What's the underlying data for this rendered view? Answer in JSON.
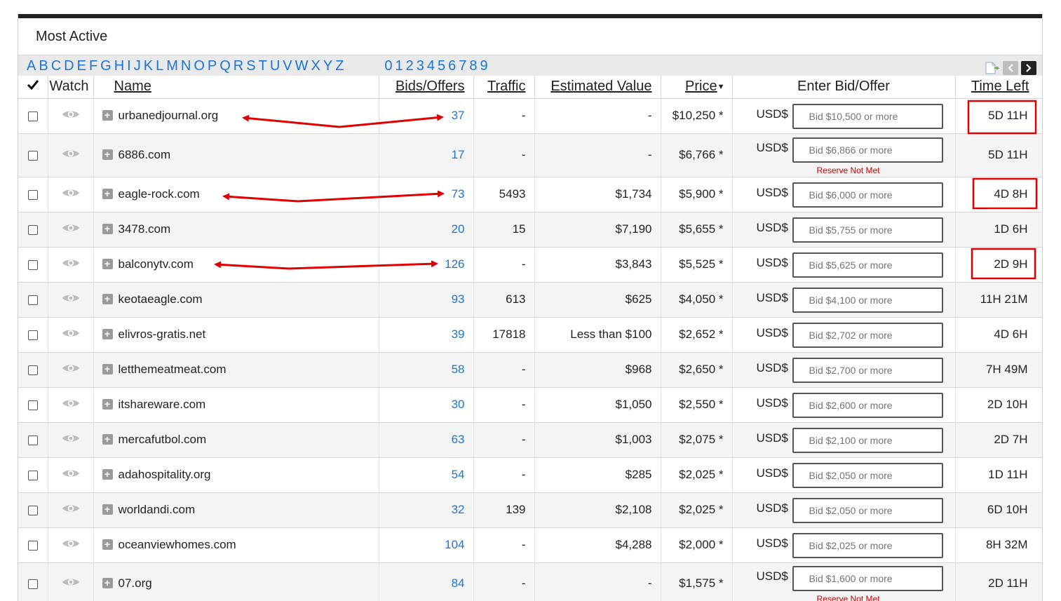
{
  "panel": {
    "title": "Most Active"
  },
  "alphabet": {
    "letters": [
      "A",
      "B",
      "C",
      "D",
      "E",
      "F",
      "G",
      "H",
      "I",
      "J",
      "K",
      "L",
      "M",
      "N",
      "O",
      "P",
      "Q",
      "R",
      "S",
      "T",
      "U",
      "V",
      "W",
      "X",
      "Y",
      "Z"
    ],
    "digits": [
      "0",
      "1",
      "2",
      "3",
      "4",
      "5",
      "6",
      "7",
      "8",
      "9"
    ]
  },
  "columns": {
    "check": "✔",
    "watch": "Watch",
    "name": "Name",
    "bids": "Bids/Offers",
    "traffic": "Traffic",
    "estimated": "Estimated Value",
    "price": "Price",
    "enter_bid": "Enter Bid/Offer",
    "time_left": "Time Left"
  },
  "currency_label": "USD$",
  "rows": [
    {
      "name": "urbanedjournal.org",
      "bids": "37",
      "traffic": "-",
      "estimated": "-",
      "price": "$10,250 *",
      "placeholder": "Bid $10,500 or more",
      "reserve": "",
      "time": "5D 11H"
    },
    {
      "name": "6886.com",
      "bids": "17",
      "traffic": "-",
      "estimated": "-",
      "price": "$6,766 *",
      "placeholder": "Bid $6,866 or more",
      "reserve": "Reserve Not Met",
      "time": "5D 11H"
    },
    {
      "name": "eagle-rock.com",
      "bids": "73",
      "traffic": "5493",
      "estimated": "$1,734",
      "price": "$5,900 *",
      "placeholder": "Bid $6,000 or more",
      "reserve": "",
      "time": "4D 8H"
    },
    {
      "name": "3478.com",
      "bids": "20",
      "traffic": "15",
      "estimated": "$7,190",
      "price": "$5,655 *",
      "placeholder": "Bid $5,755 or more",
      "reserve": "",
      "time": "1D 6H"
    },
    {
      "name": "balconytv.com",
      "bids": "126",
      "traffic": "-",
      "estimated": "$3,843",
      "price": "$5,525 *",
      "placeholder": "Bid $5,625 or more",
      "reserve": "",
      "time": "2D 9H"
    },
    {
      "name": "keotaeagle.com",
      "bids": "93",
      "traffic": "613",
      "estimated": "$625",
      "price": "$4,050 *",
      "placeholder": "Bid $4,100 or more",
      "reserve": "",
      "time": "11H 21M"
    },
    {
      "name": "elivros-gratis.net",
      "bids": "39",
      "traffic": "17818",
      "estimated": "Less than $100",
      "price": "$2,652 *",
      "placeholder": "Bid $2,702 or more",
      "reserve": "",
      "time": "4D 6H"
    },
    {
      "name": "letthemeatmeat.com",
      "bids": "58",
      "traffic": "-",
      "estimated": "$968",
      "price": "$2,650 *",
      "placeholder": "Bid $2,700 or more",
      "reserve": "",
      "time": "7H 49M"
    },
    {
      "name": "itshareware.com",
      "bids": "30",
      "traffic": "-",
      "estimated": "$1,050",
      "price": "$2,550 *",
      "placeholder": "Bid $2,600 or more",
      "reserve": "",
      "time": "2D 10H"
    },
    {
      "name": "mercafutbol.com",
      "bids": "63",
      "traffic": "-",
      "estimated": "$1,003",
      "price": "$2,075 *",
      "placeholder": "Bid $2,100 or more",
      "reserve": "",
      "time": "2D 7H"
    },
    {
      "name": "adahospitality.org",
      "bids": "54",
      "traffic": "-",
      "estimated": "$285",
      "price": "$2,025 *",
      "placeholder": "Bid $2,050 or more",
      "reserve": "",
      "time": "1D 11H"
    },
    {
      "name": "worldandi.com",
      "bids": "32",
      "traffic": "139",
      "estimated": "$2,108",
      "price": "$2,025 *",
      "placeholder": "Bid $2,050 or more",
      "reserve": "",
      "time": "6D 10H"
    },
    {
      "name": "oceanviewhomes.com",
      "bids": "104",
      "traffic": "-",
      "estimated": "$4,288",
      "price": "$2,000 *",
      "placeholder": "Bid $2,025 or more",
      "reserve": "",
      "time": "8H 32M"
    },
    {
      "name": "07.org",
      "bids": "84",
      "traffic": "-",
      "estimated": "-",
      "price": "$1,575 *",
      "placeholder": "Bid $1,600 or more",
      "reserve": "Reserve Not Met",
      "time": "2D 11H"
    }
  ],
  "annotations": {
    "color": "#e00000",
    "highlighted_rows": [
      "urbanedjournal.org",
      "eagle-rock.com",
      "balconytv.com"
    ]
  }
}
